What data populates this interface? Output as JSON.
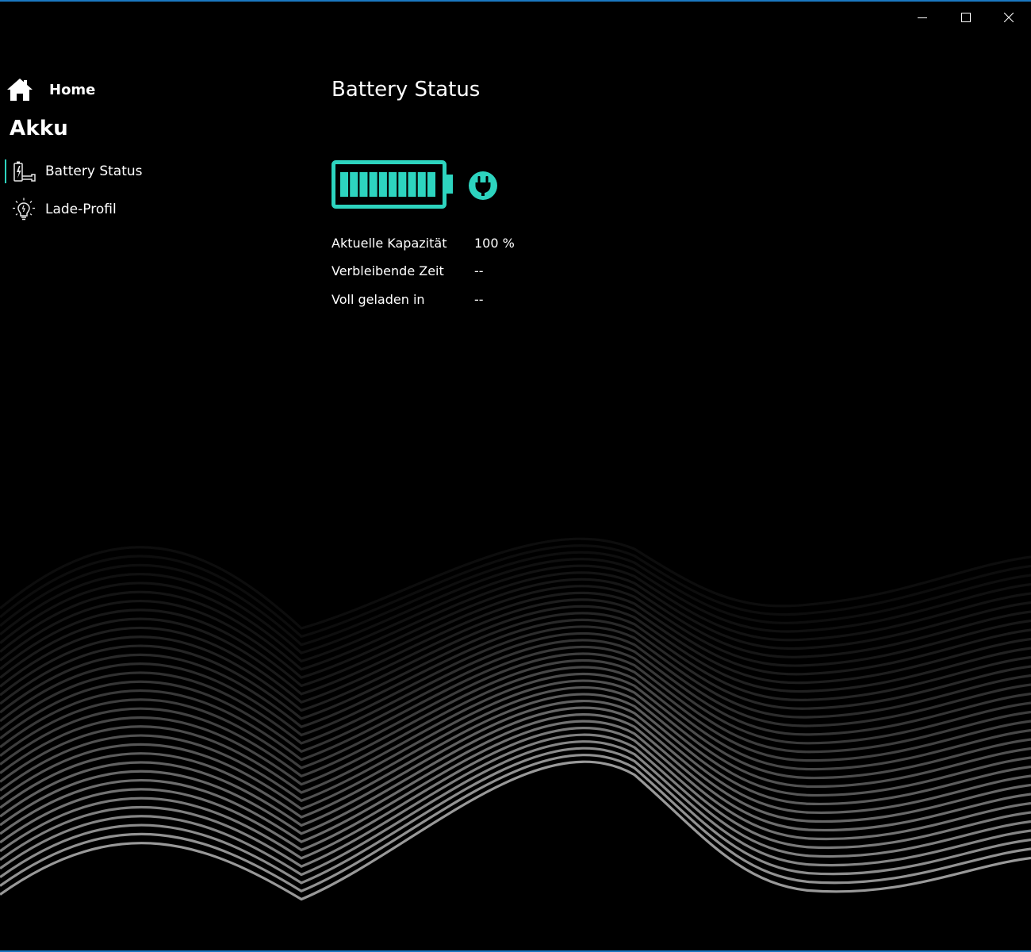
{
  "window": {
    "controls": {
      "minimize_icon": "minimize-icon",
      "maximize_icon": "maximize-icon",
      "close_icon": "close-icon"
    },
    "border_color": "#1a78c2"
  },
  "sidebar": {
    "home_label": "Home",
    "section_title": "Akku",
    "items": [
      {
        "label": "Battery Status",
        "icon": "battery-charging-icon",
        "selected": true
      },
      {
        "label": "Lade-Profil",
        "icon": "lightbulb-icon",
        "selected": false
      }
    ],
    "selection_color": "#2dd4bf"
  },
  "main": {
    "title": "Battery Status",
    "battery": {
      "level_percent": 100,
      "segments_filled": 10,
      "segments_total": 10,
      "accent_color": "#2dd4bf",
      "plugged_in_icon": "plug-icon"
    },
    "info": [
      {
        "label": "Aktuelle Kapazität",
        "value": "100 %"
      },
      {
        "label": "Verbleibende Zeit",
        "value": "--"
      },
      {
        "label": "Voll geladen in",
        "value": "--"
      }
    ]
  }
}
